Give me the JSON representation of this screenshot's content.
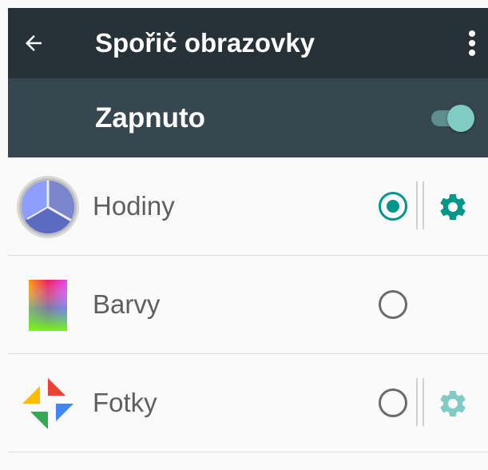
{
  "toolbar": {
    "title": "Spořič obrazovky",
    "back_icon": "arrow-back-icon",
    "more_icon": "more-vert-icon"
  },
  "master_switch": {
    "label": "Zapnuto",
    "on": true
  },
  "screensavers": [
    {
      "label": "Hodiny",
      "icon": "clock-icon",
      "selected": true,
      "has_settings": true,
      "settings_enabled": true
    },
    {
      "label": "Barvy",
      "icon": "colors-icon",
      "selected": false,
      "has_settings": false
    },
    {
      "label": "Fotky",
      "icon": "google-photos-icon",
      "selected": false,
      "has_settings": true,
      "settings_enabled": false
    }
  ],
  "colors": {
    "toolbar": "#263238",
    "switch_bar": "#37474f",
    "accent": "#009688",
    "accent_light": "#80cbc4",
    "background": "#fafafa"
  }
}
